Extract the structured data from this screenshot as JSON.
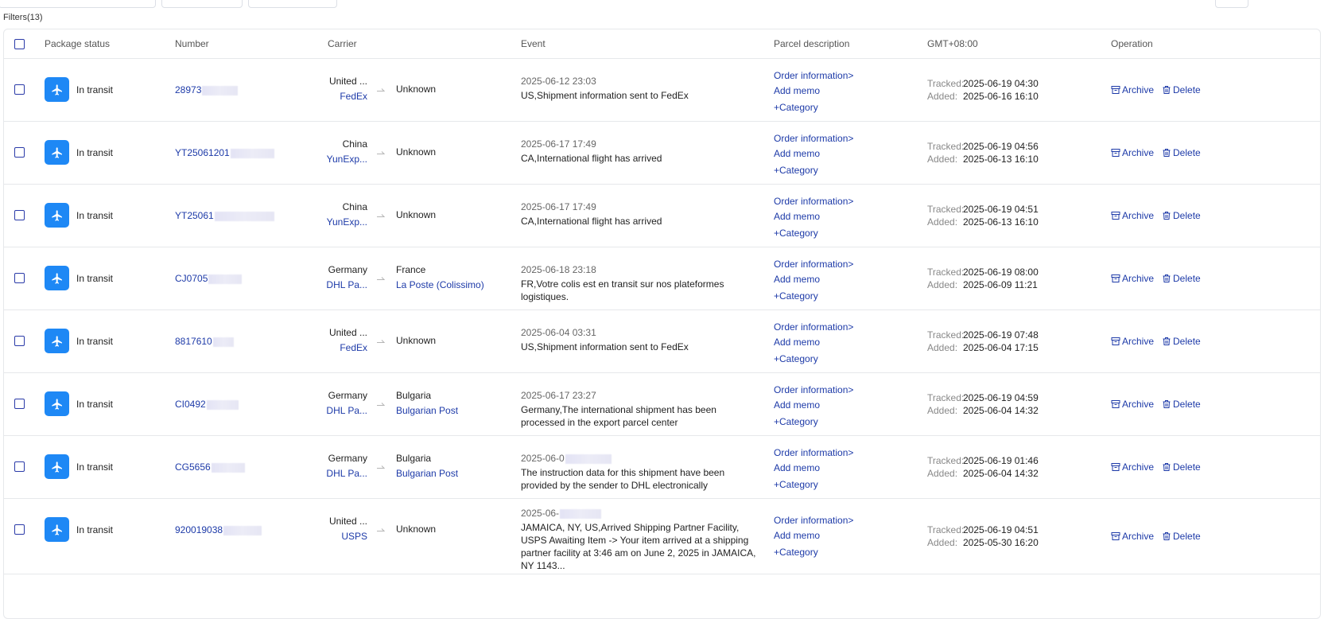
{
  "filters_label": "Filters(13)",
  "columns": {
    "package_status": "Package status",
    "number": "Number",
    "carrier": "Carrier",
    "event": "Event",
    "parcel_description": "Parcel description",
    "timezone": "GMT+08:00",
    "operation": "Operation"
  },
  "labels": {
    "order_info": "Order information>",
    "add_memo": "Add memo",
    "category": "+Category",
    "tracked": "Tracked:",
    "added": "Added:",
    "archive": "Archive",
    "delete": "Delete"
  },
  "colors": {
    "accent": "#1d3aa8",
    "status_icon_bg": "#1e88f5"
  },
  "rows": [
    {
      "status": "In transit",
      "number": "28973",
      "origin_country": "United ...",
      "origin_carrier": "FedEx",
      "dest_country": "Unknown",
      "dest_carrier": "",
      "event_time": "2025-06-12 23:03",
      "event_text": "US,Shipment information sent to FedEx",
      "tracked": "2025-06-19 04:30",
      "added": "2025-06-16 16:10"
    },
    {
      "status": "In transit",
      "number": "YT25061201",
      "origin_country": "China",
      "origin_carrier": "YunExp...",
      "dest_country": "Unknown",
      "dest_carrier": "",
      "event_time": "2025-06-17 17:49",
      "event_text": "CA,International flight has arrived",
      "tracked": "2025-06-19 04:56",
      "added": "2025-06-13 16:10"
    },
    {
      "status": "In transit",
      "number": "YT25061",
      "origin_country": "China",
      "origin_carrier": "YunExp...",
      "dest_country": "Unknown",
      "dest_carrier": "",
      "event_time": "2025-06-17 17:49",
      "event_text": "CA,International flight has arrived",
      "tracked": "2025-06-19 04:51",
      "added": "2025-06-13 16:10"
    },
    {
      "status": "In transit",
      "number": "CJ0705",
      "origin_country": "Germany",
      "origin_carrier": "DHL Pa...",
      "dest_country": "France",
      "dest_carrier": "La Poste (Colissimo)",
      "event_time": "2025-06-18 23:18",
      "event_text": "FR,Votre colis est en transit sur nos plateformes logistiques.",
      "tracked": "2025-06-19 08:00",
      "added": "2025-06-09 11:21"
    },
    {
      "status": "In transit",
      "number": "8817610",
      "origin_country": "United ...",
      "origin_carrier": "FedEx",
      "dest_country": "Unknown",
      "dest_carrier": "",
      "event_time": "2025-06-04 03:31",
      "event_text": "US,Shipment information sent to FedEx",
      "tracked": "2025-06-19 07:48",
      "added": "2025-06-04 17:15"
    },
    {
      "status": "In transit",
      "number": "CI0492",
      "origin_country": "Germany",
      "origin_carrier": "DHL Pa...",
      "dest_country": "Bulgaria",
      "dest_carrier": "Bulgarian Post",
      "event_time": "2025-06-17 23:27",
      "event_text": "Germany,The international shipment has been processed in the export parcel center",
      "tracked": "2025-06-19 04:59",
      "added": "2025-06-04 14:32"
    },
    {
      "status": "In transit",
      "number": "CG5656",
      "origin_country": "Germany",
      "origin_carrier": "DHL Pa...",
      "dest_country": "Bulgaria",
      "dest_carrier": "Bulgarian Post",
      "event_time": "2025-06-0",
      "event_text": "The instruction data for this shipment have been provided by the sender to DHL electronically",
      "tracked": "2025-06-19 01:46",
      "added": "2025-06-04 14:32"
    },
    {
      "status": "In transit",
      "number": "920019038",
      "origin_country": "United ...",
      "origin_carrier": "USPS",
      "dest_country": "Unknown",
      "dest_carrier": "",
      "event_time": "2025-06-",
      "event_text": "JAMAICA, NY, US,Arrived Shipping Partner Facility, USPS Awaiting Item -> Your item arrived at a shipping partner facility at 3:46 am on June 2, 2025 in JAMAICA, NY 1143...",
      "tracked": "2025-06-19 04:51",
      "added": "2025-05-30 16:20"
    }
  ]
}
